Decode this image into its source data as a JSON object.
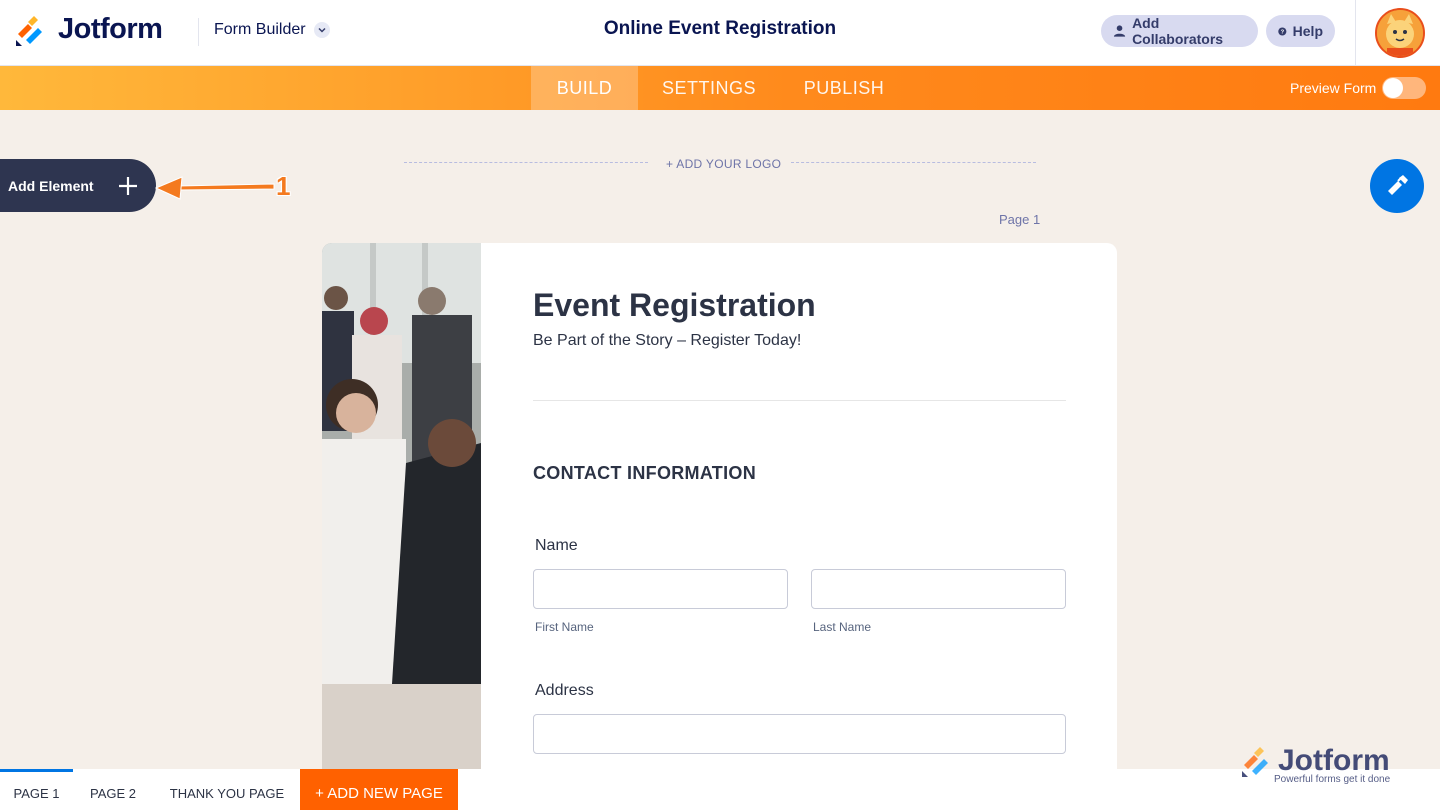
{
  "header": {
    "logo_text": "Jotform",
    "app_menu": "Form Builder",
    "form_title": "Online Event Registration",
    "collaborators_label": "Add Collaborators",
    "help_label": "Help"
  },
  "nav": {
    "tabs": [
      "BUILD",
      "SETTINGS",
      "PUBLISH"
    ],
    "active_tab": "BUILD",
    "preview_label": "Preview Form",
    "preview_on": false
  },
  "builder": {
    "add_element_label": "Add Element",
    "annotation_number": "1",
    "add_logo_label": "+ ADD YOUR LOGO",
    "page_label": "Page 1"
  },
  "form": {
    "title": "Event Registration",
    "subtitle": "Be Part of the Story – Register Today!",
    "section_heading": "CONTACT INFORMATION",
    "name_label": "Name",
    "first_name_label": "First Name",
    "last_name_label": "Last Name",
    "address_label": "Address"
  },
  "pages": {
    "tabs": [
      "PAGE 1",
      "PAGE 2",
      "THANK YOU PAGE"
    ],
    "active": "PAGE 1",
    "add_label": "+ ADD NEW PAGE"
  },
  "watermark": {
    "brand": "Jotform",
    "tagline": "Powerful forms get it done"
  },
  "colors": {
    "nav_orange": "#ff8a1c",
    "add_page_orange": "#ff6100",
    "navy": "#0a1551",
    "designer_blue": "#0075e3",
    "canvas_bg": "#f5efe9"
  }
}
